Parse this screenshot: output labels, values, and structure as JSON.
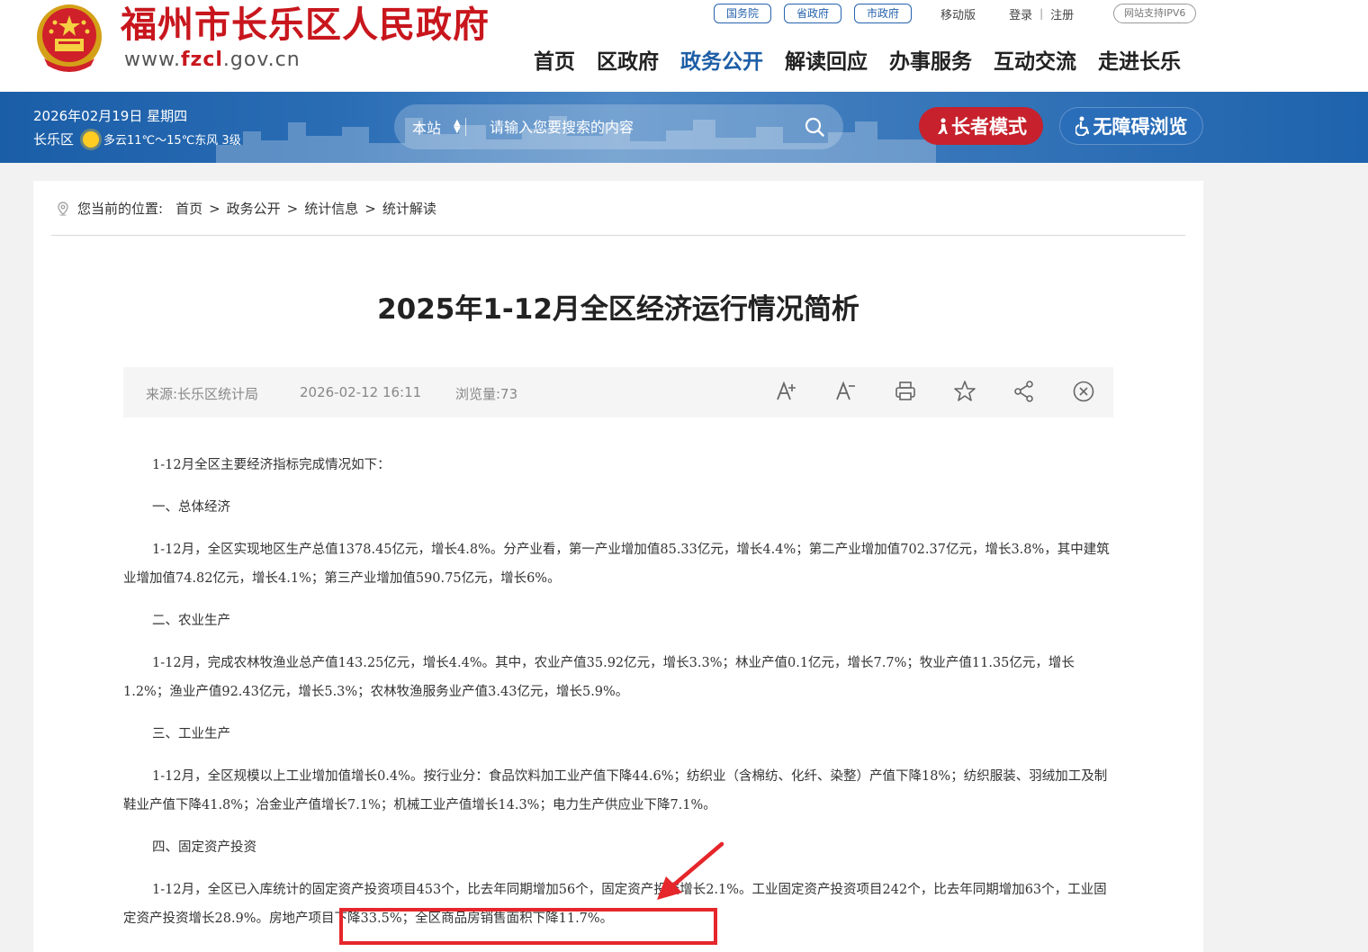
{
  "header": {
    "site_name": "福州市长乐区人民政府",
    "url_prefix": "www.",
    "url_brand": "fzcl",
    "url_suffix": ".gov.cn",
    "top_links": [
      "国务院",
      "省政府",
      "市政府"
    ],
    "mobile": "移动版",
    "login": "登录",
    "register": "注册",
    "ipv6": "网站支持IPV6",
    "nav": [
      "首页",
      "区政府",
      "政务公开",
      "解读回应",
      "办事服务",
      "互动交流",
      "走进长乐"
    ],
    "nav_active": "政务公开"
  },
  "band": {
    "date": "2026年02月19日 星期四",
    "district": "长乐区",
    "weather": "多云11℃～15℃东风 3级",
    "search_scope": "本站",
    "search_placeholder": "请输入您要搜索的内容",
    "elder_mode": "长者模式",
    "accessibility": "无障碍浏览"
  },
  "breadcrumb": {
    "prefix": "您当前的位置:",
    "items": [
      "首页",
      "政务公开",
      "统计信息",
      "统计解读"
    ]
  },
  "article": {
    "title": "2025年1-12月全区经济运行情况简析",
    "source": "来源:长乐区统计局",
    "date": "2026-02-12 16:11",
    "views": "浏览量:73",
    "paragraphs": [
      "1-12月全区主要经济指标完成情况如下：",
      "一、总体经济",
      "1-12月，全区实现地区生产总值1378.45亿元，增长4.8%。分产业看，第一产业增加值85.33亿元，增长4.4%；第二产业增加值702.37亿元，增长3.8%，其中建筑业增加值74.82亿元，增长4.1%；第三产业增加值590.75亿元，增长6%。",
      "二、农业生产",
      "1-12月，完成农林牧渔业总产值143.25亿元，增长4.4%。其中，农业产值35.92亿元，增长3.3%；林业产值0.1亿元，增长7.7%；牧业产值11.35亿元，增长1.2%；渔业产值92.43亿元，增长5.3%；农林牧渔服务业产值3.43亿元，增长5.9%。",
      "三、工业生产",
      "1-12月，全区规模以上工业增加值增长0.4%。按行业分：食品饮料加工业产值下降44.6%；纺织业（含棉纺、化纤、染整）产值下降18%；纺织服装、羽绒加工及制鞋业产值下降41.8%；冶金业产值增长7.1%；机械工业产值增长14.3%；电力生产供应业下降7.1%。",
      "四、固定资产投资"
    ],
    "last_paragraph": "1-12月，全区已入库统计的固定资产投资项目453个，比去年同期增加56个，固定资产投资增长2.1%。工业固定资产投资项目242个，比去年同期增加63个，工业固定资产投资增长28.9%。",
    "last_paragraph_tail": "房地产项目下降33.5%；全区商品房销售面积下降11.7%。"
  },
  "colors": {
    "brand_red": "#c8161d",
    "nav_blue": "#1d5ea6",
    "annotation_red": "#e5262a"
  }
}
